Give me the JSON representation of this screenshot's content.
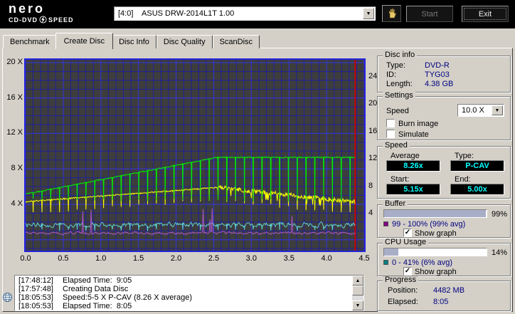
{
  "colors": {
    "window_bg": "#d4d0c8",
    "titlebar_bg": "#000000",
    "value_navy": "#000080",
    "lcd_text": "#00ffff",
    "lcd_bg": "#000000",
    "chart_bg": "#3d3d3d",
    "bar_fill_color": "#a9aec8"
  },
  "titlebar": {
    "logo_line1": "nero",
    "logo_line2_left": "CD-DVD",
    "logo_line2_right": "SPEED",
    "drive_combo_value": "[4:0]    ASUS DRW-2014L1T 1.00",
    "start_label": "Start",
    "exit_label": "Exit"
  },
  "tabs": [
    {
      "label": "Benchmark"
    },
    {
      "label": "Create Disc"
    },
    {
      "label": "Disc Info"
    },
    {
      "label": "Disc Quality"
    },
    {
      "label": "ScanDisc"
    }
  ],
  "chart_data": {
    "type": "line",
    "x_max": 4.5,
    "disc_end_gb": 4.38,
    "x_ticks": [
      {
        "v": 0,
        "label": "0.0"
      },
      {
        "v": 0.5,
        "label": "0.5"
      },
      {
        "v": 1,
        "label": "1.0"
      },
      {
        "v": 1.5,
        "label": "1.5"
      },
      {
        "v": 2,
        "label": "2.0"
      },
      {
        "v": 2.5,
        "label": "2.5"
      },
      {
        "v": 3,
        "label": "3.0"
      },
      {
        "v": 3.5,
        "label": "3.5"
      },
      {
        "v": 4,
        "label": "4.0"
      },
      {
        "v": 4.5,
        "label": "4.5"
      }
    ],
    "y_left_ticks": [
      {
        "v": 20,
        "label": "20 X"
      },
      {
        "v": 16,
        "label": "16 X"
      },
      {
        "v": 12,
        "label": "12 X"
      },
      {
        "v": 8,
        "label": "8 X"
      },
      {
        "v": 4,
        "label": "4 X"
      }
    ],
    "y_right_ticks": [
      {
        "v": 24,
        "label": "24"
      },
      {
        "v": 20,
        "label": "20"
      },
      {
        "v": 16,
        "label": "16"
      },
      {
        "v": 12,
        "label": "12"
      },
      {
        "v": 8,
        "label": "8"
      },
      {
        "v": 4,
        "label": "4"
      }
    ],
    "grid_minor": "#20209c",
    "grid_major": "#3434e6",
    "border_color": "#2323dd",
    "position_line_color": "#cc0000",
    "spike_start_gb": 0.1,
    "spike_interval_gb": 0.117,
    "series": [
      {
        "name": "buffer-level",
        "color": "#5ecccc",
        "base": 1.7,
        "noise": 0.45,
        "dip_floor": 0.95
      },
      {
        "name": "cpu-usage",
        "color": "#aa55c8",
        "base": 0.75,
        "noise": 0.28,
        "spike_top": 3.6
      },
      {
        "name": "rotation-speed",
        "color": "#ffff00",
        "start": 4.3,
        "peak": 5.9,
        "peak_gb": 2.55,
        "end": 4.25,
        "spike_depth": 1.2,
        "spike_floor_min": 3.1
      },
      {
        "name": "write-speed",
        "color": "#00ee00",
        "start": 5.15,
        "max": 9.3,
        "cav_end_gb": 2.55,
        "spike_floor": 4.45
      }
    ]
  },
  "disc_info": {
    "title": "Disc info",
    "type_label": "Type:",
    "type_value": "DVD-R",
    "id_label": "ID:",
    "id_value": "TYG03",
    "length_label": "Length:",
    "length_value": "4.38 GB"
  },
  "settings": {
    "title": "Settings",
    "speed_label": "Speed",
    "speed_value": "10.0 X",
    "burn_image_label": "Burn image",
    "burn_image_checked": false,
    "simulate_label": "Simulate",
    "simulate_checked": false
  },
  "speed_panel": {
    "title": "Speed",
    "average_label": "Average",
    "average_value": "8.26x",
    "type_label": "Type:",
    "type_value": "P-CAV",
    "start_label": "Start:",
    "start_value": "5.15x",
    "end_label": "End:",
    "end_value": "5.00x"
  },
  "buffer": {
    "title": "Buffer",
    "percent": "99%",
    "bar_fill": 99,
    "range_text": "99 - 100% (99% avg)",
    "swatch_color": "#800080",
    "show_graph_label": "Show graph",
    "show_graph_checked": true
  },
  "cpu": {
    "title": "CPU Usage",
    "percent": "14%",
    "bar_fill": 14,
    "range_text": "0 - 41% (6% avg)",
    "swatch_color": "#008080",
    "show_graph_label": "Show graph",
    "show_graph_checked": true
  },
  "progress": {
    "title": "Progress",
    "position_label": "Position:",
    "position_value": "4482 MB",
    "elapsed_label": "Elapsed:",
    "elapsed_value": "8:05"
  },
  "log": {
    "lines": [
      {
        "time": "[17:48:12]",
        "text": "Elapsed Time:  9:05"
      },
      {
        "time": "[17:57:48]",
        "text": "Creating Data Disc"
      },
      {
        "time": "[18:05:53]",
        "text": "Speed:5-5 X P-CAV (8.26 X average)"
      },
      {
        "time": "[18:05:53]",
        "text": "Elapsed Time:  8:05"
      }
    ]
  }
}
